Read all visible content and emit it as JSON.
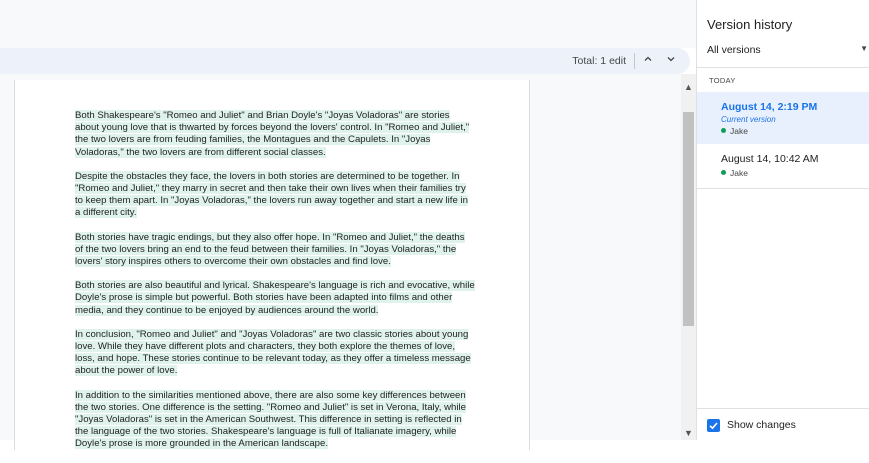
{
  "editbar": {
    "total": "Total: 1 edit",
    "up_icon": "chevron-up-icon",
    "down_icon": "chevron-down-icon"
  },
  "document": {
    "paragraphs": [
      "Both Shakespeare's \"Romeo and Juliet\" and Brian Doyle's \"Joyas Voladoras\" are stories about young love that is thwarted by forces beyond the lovers' control. In \"Romeo and Juliet,\" the two lovers are from feuding families, the Montagues and the Capulets. In \"Joyas Voladoras,\" the two lovers are from different social classes.",
      "Despite the obstacles they face, the lovers in both stories are determined to be together. In \"Romeo and Juliet,\" they marry in secret and then take their own lives when their families try to keep them apart. In \"Joyas Voladoras,\" the lovers run away together and start a new life in a different city.",
      "Both stories have tragic endings, but they also offer hope. In \"Romeo and Juliet,\" the deaths of the two lovers bring an end to the feud between their families. In \"Joyas Voladoras,\" the lovers' story inspires others to overcome their own obstacles and find love.",
      "Both stories are also beautiful and lyrical. Shakespeare's language is rich and evocative, while Doyle's prose is simple but powerful. Both stories have been adapted into films and other media, and they continue to be enjoyed by audiences around the world.",
      "In conclusion, \"Romeo and Juliet\" and \"Joyas Voladoras\" are two classic stories about young love. While they have different plots and characters, they both explore the themes of love, loss, and hope. These stories continue to be relevant today, as they offer a timeless message about the power of love.",
      "In addition to the similarities mentioned above, there are also some key differences between the two stories. One difference is the setting. \"Romeo and Juliet\" is set in Verona, Italy, while \"Joyas Voladoras\" is set in the American Southwest. This difference in setting is reflected in the language of the two stories. Shakespeare's language is full of Italianate imagery, while Doyle's prose is more grounded in the American landscape."
    ],
    "highlight_color": "#dff3ec"
  },
  "panel": {
    "title": "Version history",
    "filter_value": "All versions",
    "section_label": "TODAY",
    "versions": [
      {
        "date": "August 14, 2:19 PM",
        "subtitle": "Current version",
        "user": "Jake",
        "selected": true
      },
      {
        "date": "August 14, 10:42 AM",
        "user": "Jake",
        "selected": false
      }
    ],
    "show_changes_label": "Show changes",
    "show_changes_checked": true
  },
  "colors": {
    "accent": "#1a73e8",
    "user_dot": "#0f9d58",
    "selected_bg": "#e8f0fe"
  }
}
